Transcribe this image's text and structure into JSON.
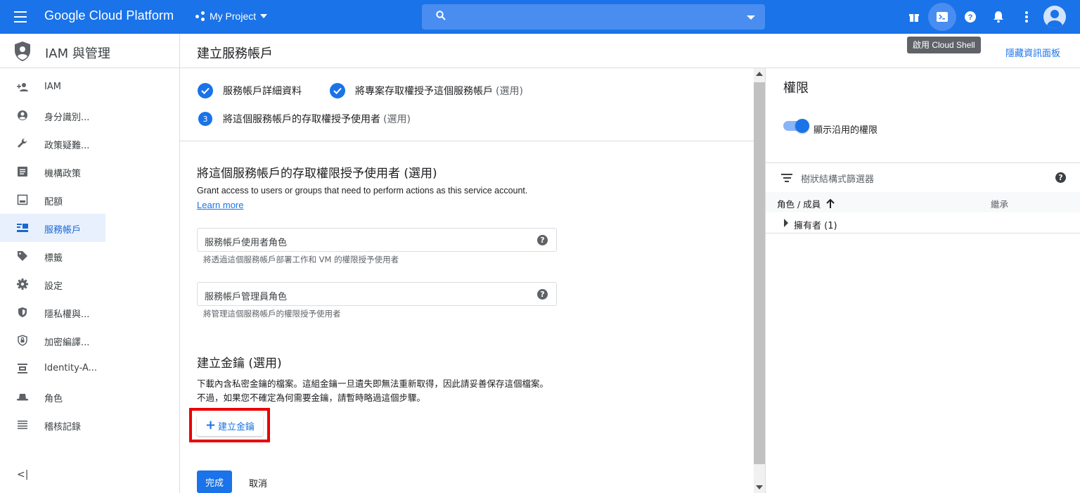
{
  "topbar": {
    "brand": "Google Cloud Platform",
    "project": "My Project",
    "search_placeholder": "",
    "tooltip": "啟用 Cloud Shell"
  },
  "sidebar": {
    "title": "IAM 與管理",
    "items": [
      {
        "label": "IAM",
        "icon": "person-add-icon",
        "active": false
      },
      {
        "label": "身分識別...",
        "icon": "account-circle-icon",
        "active": false
      },
      {
        "label": "政策疑難...",
        "icon": "wrench-icon",
        "active": false
      },
      {
        "label": "機構政策",
        "icon": "list-box-icon",
        "active": false
      },
      {
        "label": "配額",
        "icon": "quota-icon",
        "active": false
      },
      {
        "label": "服務帳戶",
        "icon": "service-account-icon",
        "active": true
      },
      {
        "label": "標籤",
        "icon": "tag-icon",
        "active": false
      },
      {
        "label": "設定",
        "icon": "gear-icon",
        "active": false
      },
      {
        "label": "隱私權與...",
        "icon": "shield-icon",
        "active": false
      },
      {
        "label": "加密編譯...",
        "icon": "lock-shield-icon",
        "active": false
      },
      {
        "label": "Identity-A...",
        "icon": "identity-icon",
        "active": false
      },
      {
        "label": "角色",
        "icon": "hat-icon",
        "active": false
      },
      {
        "label": "稽核記錄",
        "icon": "lines-icon",
        "active": false
      }
    ],
    "collapse_label": "<|"
  },
  "page": {
    "title": "建立服務帳戶",
    "hide_panel": "隱藏資訊面板"
  },
  "steps": [
    {
      "label": "服務帳戶詳細資料",
      "optional": "",
      "state": "done"
    },
    {
      "label": "將專案存取權授予這個服務帳戶",
      "optional": "(選用)",
      "state": "done"
    },
    {
      "label": "將這個服務帳戶的存取權授予使用者",
      "optional": "(選用)",
      "state": "current",
      "number": "3"
    }
  ],
  "grant": {
    "title": "將這個服務帳戶的存取權限授予使用者 (選用)",
    "desc": "Grant access to users or groups that need to perform actions as this service account.",
    "learn_more": "Learn more",
    "field1_label": "服務帳戶使用者角色",
    "field1_hint": "將透過這個服務帳戶部署工作和 VM 的權限授予使用者",
    "field2_label": "服務帳戶管理員角色",
    "field2_hint": "將管理這個服務帳戶的權限授予使用者"
  },
  "key": {
    "title": "建立金鑰 (選用)",
    "desc1": "下載內含私密金鑰的檔案。這組金鑰一旦遺失即無法重新取得，因此請妥善保存這個檔案。",
    "desc2": "不過，如果您不確定為何需要金鑰，請暫時略過這個步驟。",
    "button": "建立金鑰"
  },
  "actions": {
    "done": "完成",
    "cancel": "取消"
  },
  "panel": {
    "title": "權限",
    "toggle_label": "顯示沿用的權限",
    "toggle_on": true,
    "filter_label": "樹狀結構式篩選器",
    "col_role": "角色 / 成員",
    "col_inherit": "繼承",
    "row": "擁有者 (1)"
  },
  "colors": {
    "brand_blue": "#1a73e8",
    "highlight_red": "#ea0000"
  }
}
